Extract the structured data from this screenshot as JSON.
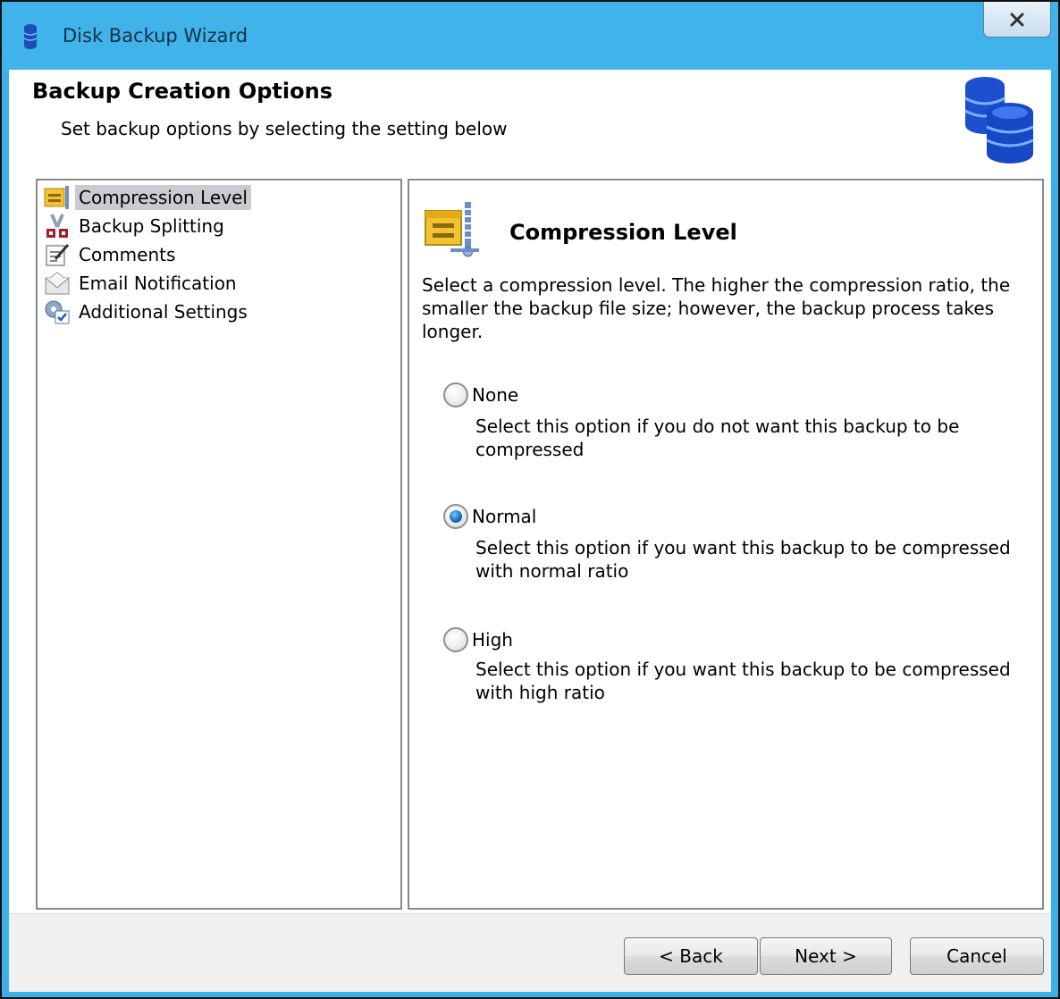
{
  "window": {
    "title": "Disk Backup Wizard",
    "close_glyph": "X"
  },
  "header": {
    "title": "Backup Creation Options",
    "subtitle": "Set backup options by selecting the setting below",
    "icon": "database-stack-icon"
  },
  "nav": {
    "items": [
      {
        "label": "Compression Level",
        "icon": "compression-icon",
        "selected": true
      },
      {
        "label": "Backup Splitting",
        "icon": "scissors-icon",
        "selected": false
      },
      {
        "label": "Comments",
        "icon": "notepad-icon",
        "selected": false
      },
      {
        "label": "Email Notification",
        "icon": "envelope-icon",
        "selected": false
      },
      {
        "label": "Additional Settings",
        "icon": "settings-checklist-icon",
        "selected": false
      }
    ]
  },
  "content": {
    "title": "Compression Level",
    "description": "Select a compression level. The higher the compression ratio, the smaller the backup file size; however, the backup process takes longer.",
    "options": [
      {
        "label": "None",
        "description": "Select this option if you do not want this backup to be compressed",
        "checked": false
      },
      {
        "label": "Normal",
        "description": "Select this option if you want this backup to be compressed with normal ratio",
        "checked": true
      },
      {
        "label": "High",
        "description": "Select this option if you want this backup to be compressed with high ratio",
        "checked": false
      }
    ]
  },
  "buttons": {
    "back": "< Back",
    "next": "Next >",
    "cancel": "Cancel"
  },
  "colors": {
    "titlebar": "#40b3ea",
    "selected_item_bg": "#c9cbd0",
    "radio_checked": "#1f6fc0"
  }
}
